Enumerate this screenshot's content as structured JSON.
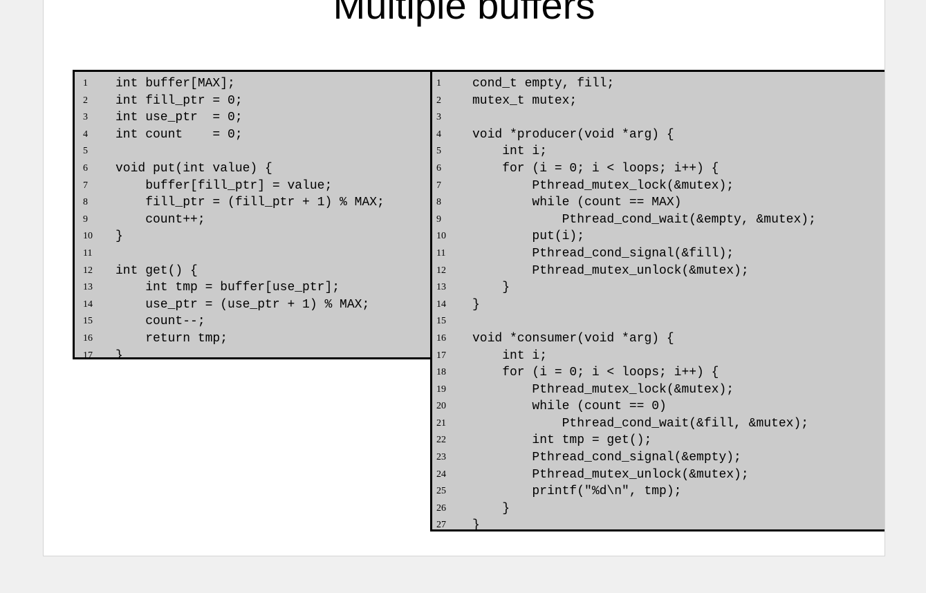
{
  "slide": {
    "title": "Multiple buffers"
  },
  "left_code": {
    "lines": [
      {
        "num": "1",
        "text": "int buffer[MAX];"
      },
      {
        "num": "2",
        "text": "int fill_ptr = 0;"
      },
      {
        "num": "3",
        "text": "int use_ptr  = 0;"
      },
      {
        "num": "4",
        "text": "int count    = 0;"
      },
      {
        "num": "5",
        "text": ""
      },
      {
        "num": "6",
        "text": "void put(int value) {"
      },
      {
        "num": "7",
        "text": "    buffer[fill_ptr] = value;"
      },
      {
        "num": "8",
        "text": "    fill_ptr = (fill_ptr + 1) % MAX;"
      },
      {
        "num": "9",
        "text": "    count++;"
      },
      {
        "num": "10",
        "text": "}"
      },
      {
        "num": "11",
        "text": ""
      },
      {
        "num": "12",
        "text": "int get() {"
      },
      {
        "num": "13",
        "text": "    int tmp = buffer[use_ptr];"
      },
      {
        "num": "14",
        "text": "    use_ptr = (use_ptr + 1) % MAX;"
      },
      {
        "num": "15",
        "text": "    count--;"
      },
      {
        "num": "16",
        "text": "    return tmp;"
      },
      {
        "num": "17",
        "text": "}"
      }
    ]
  },
  "right_code": {
    "lines": [
      {
        "num": "1",
        "text": "cond_t empty, fill;"
      },
      {
        "num": "2",
        "text": "mutex_t mutex;"
      },
      {
        "num": "3",
        "text": ""
      },
      {
        "num": "4",
        "text": "void *producer(void *arg) {"
      },
      {
        "num": "5",
        "text": "    int i;"
      },
      {
        "num": "6",
        "text": "    for (i = 0; i < loops; i++) {"
      },
      {
        "num": "7",
        "text": "        Pthread_mutex_lock(&mutex);"
      },
      {
        "num": "8",
        "text": "        while (count == MAX)"
      },
      {
        "num": "9",
        "text": "            Pthread_cond_wait(&empty, &mutex);"
      },
      {
        "num": "10",
        "text": "        put(i);"
      },
      {
        "num": "11",
        "text": "        Pthread_cond_signal(&fill);"
      },
      {
        "num": "12",
        "text": "        Pthread_mutex_unlock(&mutex);"
      },
      {
        "num": "13",
        "text": "    }"
      },
      {
        "num": "14",
        "text": "}"
      },
      {
        "num": "15",
        "text": ""
      },
      {
        "num": "16",
        "text": "void *consumer(void *arg) {"
      },
      {
        "num": "17",
        "text": "    int i;"
      },
      {
        "num": "18",
        "text": "    for (i = 0; i < loops; i++) {"
      },
      {
        "num": "19",
        "text": "        Pthread_mutex_lock(&mutex);"
      },
      {
        "num": "20",
        "text": "        while (count == 0)"
      },
      {
        "num": "21",
        "text": "            Pthread_cond_wait(&fill, &mutex);"
      },
      {
        "num": "22",
        "text": "        int tmp = get();"
      },
      {
        "num": "23",
        "text": "        Pthread_cond_signal(&empty);"
      },
      {
        "num": "24",
        "text": "        Pthread_mutex_unlock(&mutex);"
      },
      {
        "num": "25",
        "text": "        printf(\"%d\\n\", tmp);"
      },
      {
        "num": "26",
        "text": "    }"
      },
      {
        "num": "27",
        "text": "}"
      }
    ]
  }
}
